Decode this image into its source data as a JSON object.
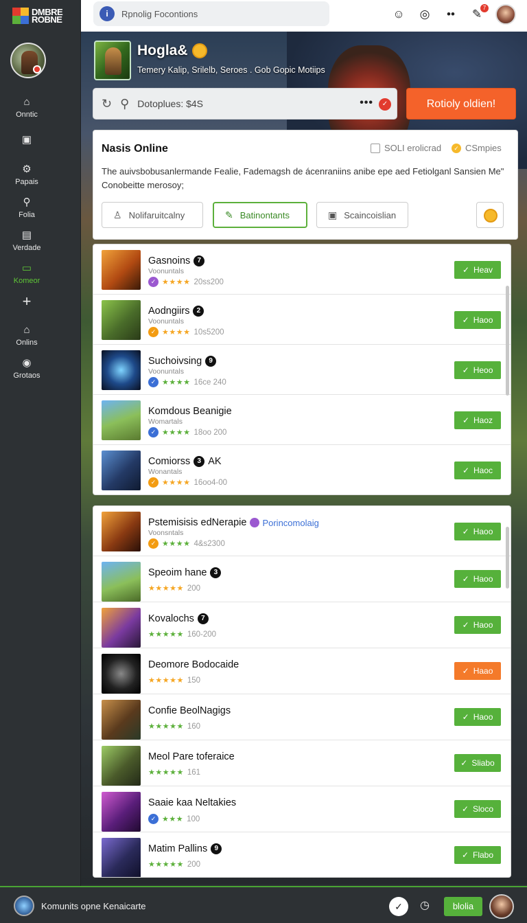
{
  "app": {
    "logo_text": "DMBRE ROBNE"
  },
  "sidebar": {
    "items": [
      {
        "label": "Onntic",
        "icon": "home-icon"
      },
      {
        "label": "",
        "icon": "screen-icon"
      },
      {
        "label": "Papais",
        "icon": "gear-icon"
      },
      {
        "label": "Folia",
        "icon": "search-icon"
      },
      {
        "label": "Verdade",
        "icon": "monitor-icon"
      },
      {
        "label": "Komeor",
        "icon": "store-icon",
        "active": true
      },
      {
        "label": "",
        "icon": "plus-icon"
      },
      {
        "label": "Onlins",
        "icon": "home-icon"
      },
      {
        "label": "Grotaos",
        "icon": "circle-icon"
      }
    ]
  },
  "topbar": {
    "search_placeholder": "Rpnolig Focontions",
    "info_glyph": "i",
    "notif_count": "7"
  },
  "hero": {
    "title": "Hogla&",
    "subtitle": "Temery Kalip, Srilelb, Seroes . Gob Gopic Motiips",
    "search_value": "Dotoplues: $4S",
    "more_glyph": "•••",
    "cta_label": "Rotioly oldien!"
  },
  "card": {
    "title": "Nasis Online",
    "opt1": "SOLI erolicrad",
    "opt2": "CSmpies",
    "description": "The auivsbobusanlermande Fealie, Fademagsh de ácenraniins anibe epe aed Fetiolganl Sansien Me\" Conobeitte merosoy;",
    "filters": [
      "Nolifaruitcalny",
      "Batinontants",
      "Scaincoislian"
    ]
  },
  "list_a": [
    {
      "name": "Gasnoins",
      "num": "7",
      "sub": "Voonuntals",
      "stars": "★★★★",
      "meta": "20ss200",
      "btn": "Heav"
    },
    {
      "name": "Aodngiirs",
      "num": "2",
      "sub": "Voonuntals",
      "stars": "★★★★",
      "meta": "10s5200",
      "btn": "Haoo"
    },
    {
      "name": "Suchoivsing",
      "num": "9",
      "sub": "Voonuntals",
      "stars": "★★★★",
      "meta": "16ce 240",
      "btn": "Heoo"
    },
    {
      "name": "Komdous Beanigie",
      "num": "",
      "sub": "Womartals",
      "stars": "★★★★",
      "meta": "18oo 200",
      "btn": "Haoz"
    },
    {
      "name": "Comiorss",
      "num": "3",
      "extra": "AK",
      "sub": "Wonantals",
      "stars": "★★★★",
      "meta": "16oo4-00",
      "btn": "Haoc"
    }
  ],
  "list_b": [
    {
      "name": "Pstemisisis edNerapie",
      "tag": "Porincomolaig",
      "sub": "Voonsntals",
      "stars": "★★★★",
      "meta": "4&s2300",
      "btn": "Haoo"
    },
    {
      "name": "Speoim hane",
      "num": "3",
      "stars": "★★★★★",
      "meta": "200",
      "btn": "Haoo"
    },
    {
      "name": "Kovalochs",
      "num": "7",
      "stars": "★★★★★",
      "meta": "160-200",
      "btn": "Haoo"
    },
    {
      "name": "Deomore Bodocaide",
      "stars": "★★★★★",
      "meta": "150",
      "btn": "Haao"
    },
    {
      "name": "Confie BeolNagigs",
      "stars": "★★★★★",
      "meta": "160",
      "btn": "Haoo"
    },
    {
      "name": "Meol Pare toferaice",
      "stars": "★★★★★",
      "meta": "161",
      "btn": "Sliabo"
    },
    {
      "name": "Saaie kaa Neltakies",
      "stars": "★★★",
      "meta": "100",
      "btn": "Sloco"
    },
    {
      "name": "Matim Pallins",
      "num": "9",
      "stars": "★★★★★",
      "meta": "200",
      "btn": "Flabo"
    }
  ],
  "bottombar": {
    "text": "Komunits opne Kenaicarte",
    "btn": "blolia"
  },
  "colors": {
    "accent_green": "#56b13b",
    "accent_orange": "#f4622a",
    "sidebar_bg": "#2d3134"
  }
}
